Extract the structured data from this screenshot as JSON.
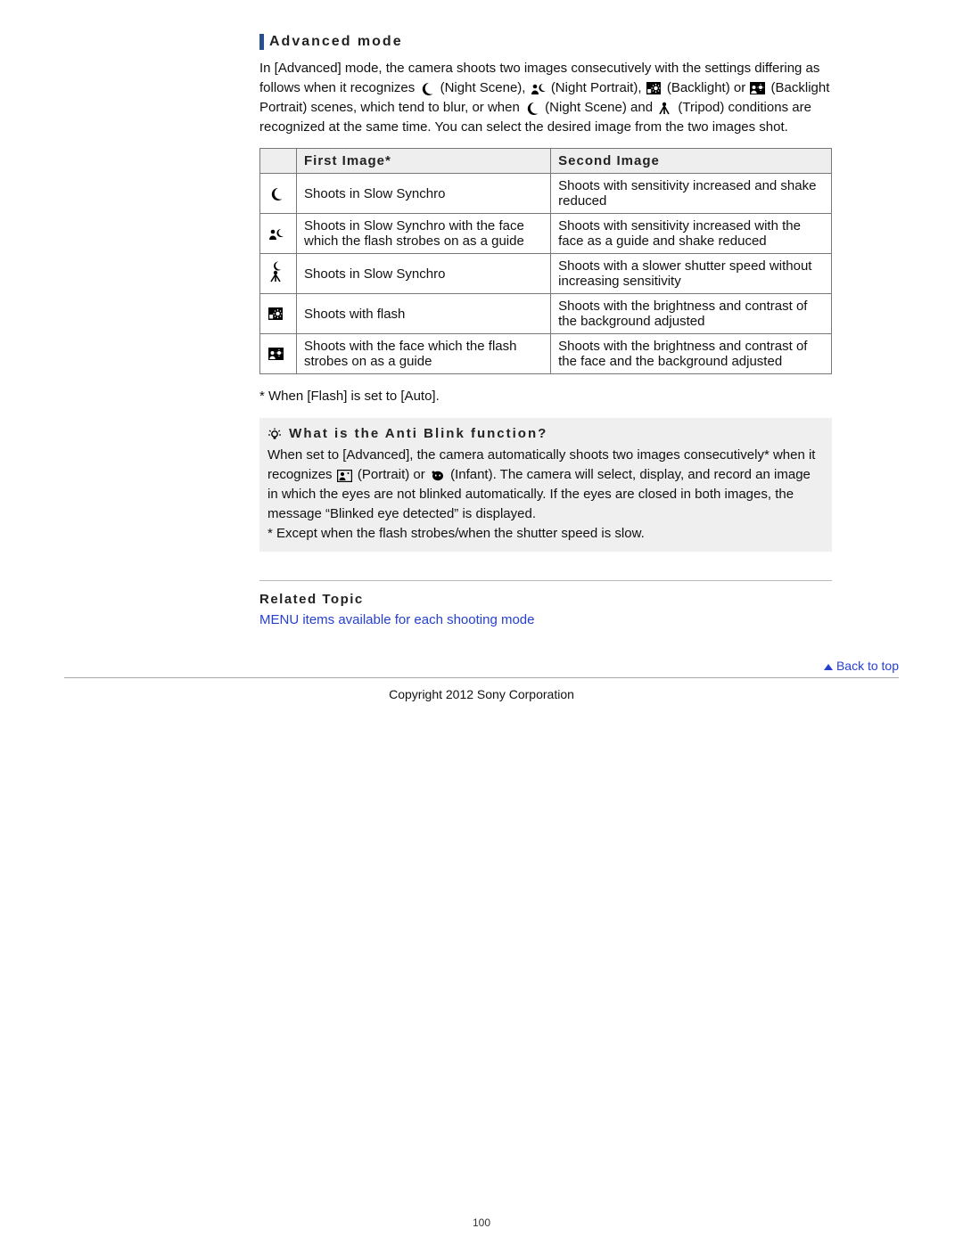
{
  "heading": "Advanced mode",
  "intro": {
    "part1": "In [Advanced] mode, the camera shoots two images consecutively with the settings differing as follows when it recognizes ",
    "night_scene_label": "(Night Scene), ",
    "night_portrait_label": "(Night Portrait), ",
    "backlight_label": "(Backlight) or ",
    "backlight_portrait_label": "(Backlight Portrait) scenes, which tend to blur, or when ",
    "night_scene_label2": "(Night Scene) and ",
    "tripod_label": "(Tripod) conditions are recognized at the same time. You can select the desired image from the two images shot."
  },
  "table": {
    "headers": {
      "col1": "First Image*",
      "col2": "Second Image"
    },
    "rows": [
      {
        "icon": "night-scene-icon",
        "first": "Shoots in Slow Synchro",
        "second": "Shoots with sensitivity increased and shake reduced"
      },
      {
        "icon": "night-portrait-icon",
        "first": "Shoots in Slow Synchro with the face which the flash strobes on as a guide",
        "second": "Shoots with sensitivity increased with the face as a guide and shake reduced"
      },
      {
        "icon": "night-tripod-icon",
        "first": "Shoots in Slow Synchro",
        "second": "Shoots with a slower shutter speed without increasing sensitivity"
      },
      {
        "icon": "backlight-icon",
        "first": "Shoots with flash",
        "second": "Shoots with the brightness and contrast of the background adjusted"
      },
      {
        "icon": "backlight-portrait-icon",
        "first": "Shoots with the face which the flash strobes on as a guide",
        "second": "Shoots with the brightness and contrast of the face and the background adjusted"
      }
    ]
  },
  "footnote": "* When [Flash] is set to [Auto].",
  "tip": {
    "heading": "What is the Anti Blink function?",
    "part1": "When set to [Advanced], the camera automatically shoots two images consecutively* when it recognizes ",
    "portrait_label": "(Portrait) or ",
    "infant_label": "(Infant). The camera will select, display, and record an image in which the eyes are not blinked automatically. If the eyes are closed in both images, the message “Blinked eye detected” is displayed.",
    "note": "* Except when the flash strobes/when the shutter speed is slow."
  },
  "related": {
    "heading": "Related Topic",
    "link": "MENU items available for each shooting mode"
  },
  "back_to_top": "Back to top",
  "copyright": "Copyright 2012 Sony Corporation",
  "page_number": "100"
}
